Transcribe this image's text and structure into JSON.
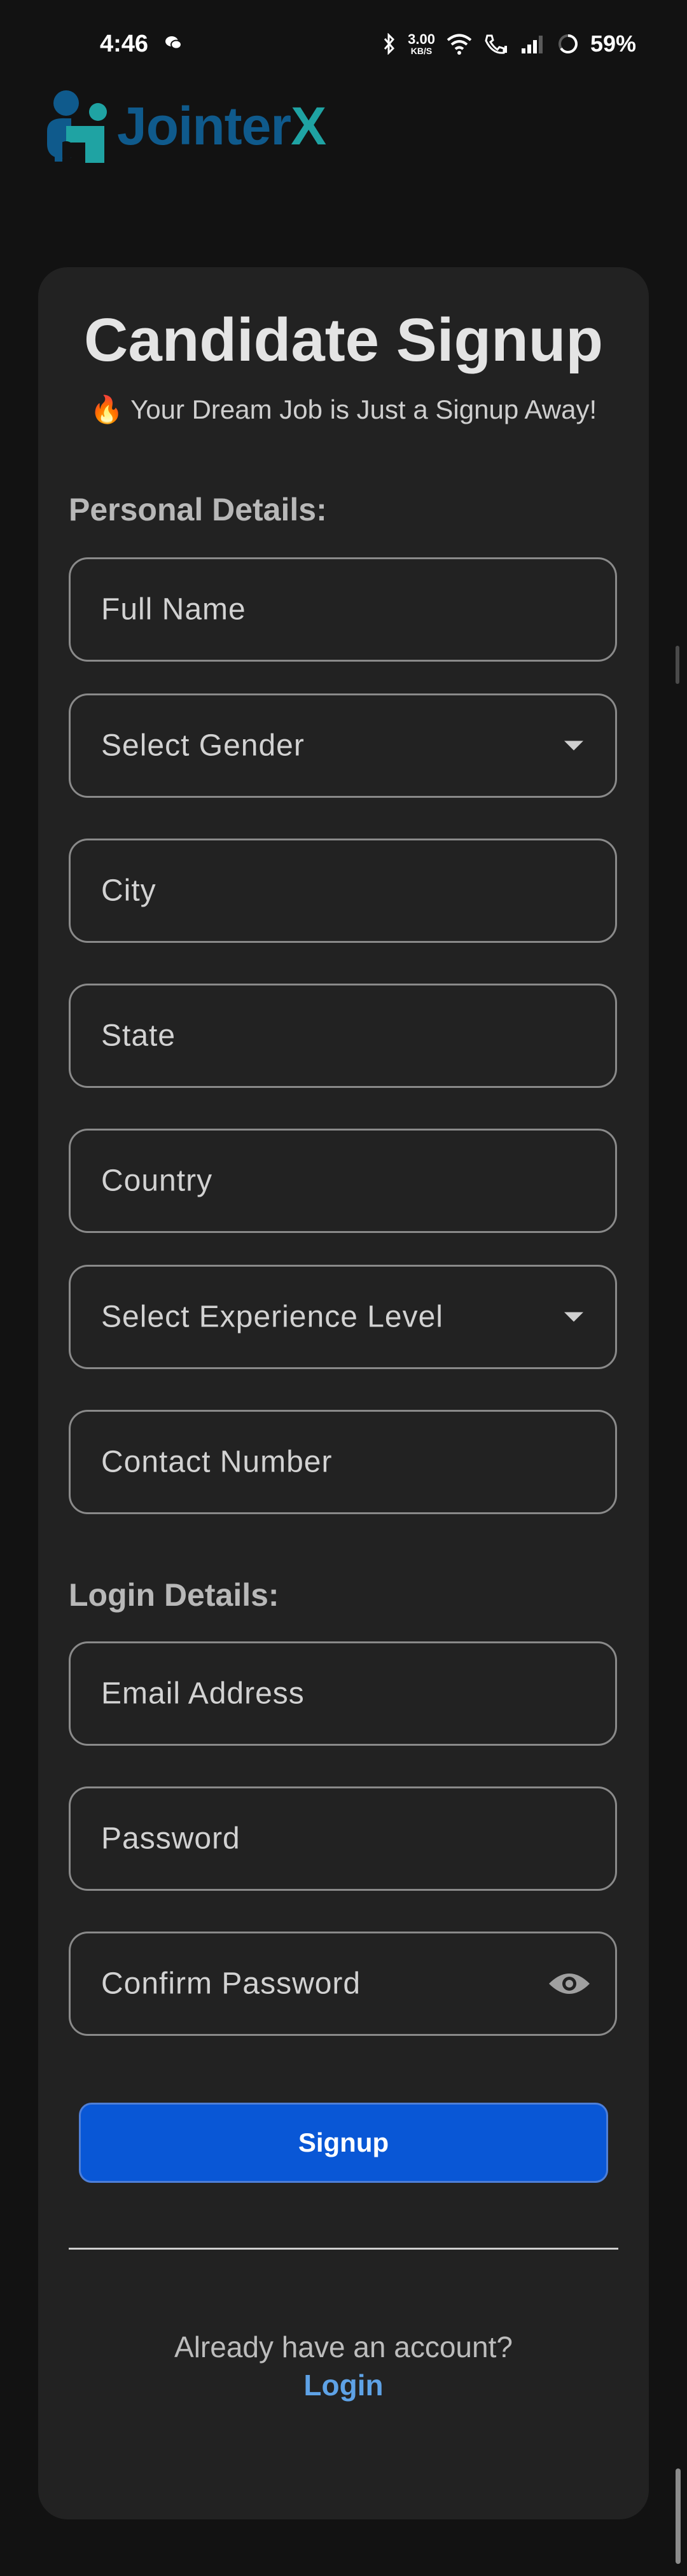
{
  "status_bar": {
    "time": "4:46",
    "net_speed_value": "3.00",
    "net_speed_unit": "KB/S",
    "battery": "59%",
    "icons": [
      "wechat-icon",
      "bluetooth-icon",
      "wifi-icon",
      "wifi-call-icon",
      "signal-icon",
      "battery-icon"
    ]
  },
  "logo": {
    "text_main": "Jointer",
    "text_accent": "X",
    "colors": {
      "main": "#0f5a8c",
      "accent": "#1fa3a3"
    }
  },
  "form": {
    "title": "Candidate Signup",
    "subtitle": "🔥 Your Dream Job is Just a Signup Away!",
    "personal_label": "Personal Details:",
    "login_label": "Login Details:",
    "fields": {
      "full_name": "Full Name",
      "gender": "Select Gender",
      "city": "City",
      "state": "State",
      "country": "Country",
      "experience": "Select Experience Level",
      "contact": "Contact Number",
      "email": "Email Address",
      "password": "Password",
      "confirm_password": "Confirm Password"
    },
    "signup_button": "Signup",
    "already_text": "Already have an account?",
    "login_link": "Login"
  },
  "colors": {
    "background": "#121212",
    "card": "#222222",
    "primary_button": "#0957d6",
    "link": "#5ea2e6"
  }
}
